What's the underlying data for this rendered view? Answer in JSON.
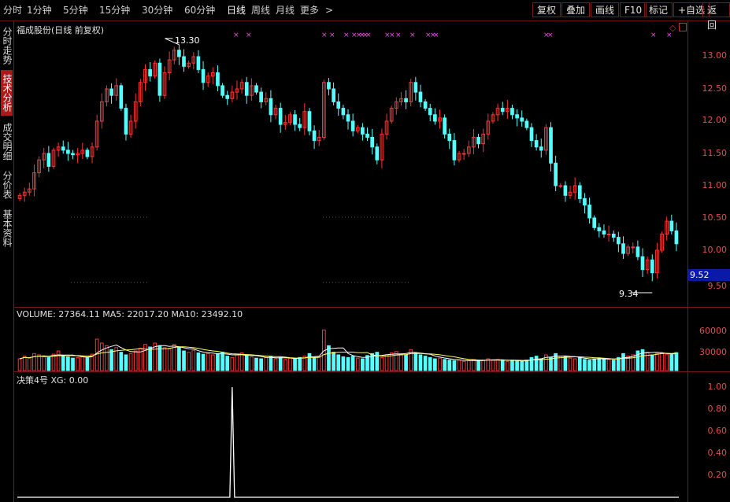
{
  "toolbar": {
    "periods": [
      "分时",
      "1分钟",
      "5分钟",
      "15分钟",
      "30分钟",
      "60分钟",
      "日线",
      "周线",
      "月线",
      "更多"
    ],
    "active_period": "日线",
    "more_arrow": ">",
    "buttons": [
      "复权",
      "叠加",
      "画线",
      "F10",
      "标记",
      "+自选",
      "返回"
    ]
  },
  "sidebar": {
    "tabs": [
      "分时走势",
      "技术分析",
      "成交明细",
      "分价表",
      "基本资料"
    ],
    "active": "技术分析"
  },
  "main_panel": {
    "title": "福成股份(日线 前复权)",
    "high_label": "13.30",
    "low_label": "9.34",
    "current_price": "9.52",
    "axis_labels": [
      "13.00",
      "12.50",
      "12.00",
      "11.50",
      "11.00",
      "10.50",
      "10.00",
      "9.50"
    ]
  },
  "volume_panel": {
    "title": "VOLUME: 27364.11  MA5: 22017.20  MA10: 23492.10",
    "axis_labels": [
      "60000",
      "30000"
    ]
  },
  "indicator_panel": {
    "title": "决策4号  XG: 0.00",
    "axis_labels": [
      "1.00",
      "0.80",
      "0.60",
      "0.40",
      "0.20"
    ]
  },
  "colors": {
    "up": "#ff3232",
    "down": "#54ffff",
    "frame": "#7a1a1a",
    "marker": "#ff40ff",
    "ma5": "#ffffff",
    "ma10": "#ffff60"
  },
  "chart_data": {
    "type": "candlestick",
    "closes": [
      10.85,
      10.9,
      10.95,
      11.2,
      11.4,
      11.5,
      11.3,
      11.55,
      11.6,
      11.55,
      11.5,
      11.48,
      11.5,
      11.55,
      11.45,
      11.6,
      12.0,
      12.3,
      12.5,
      12.4,
      12.55,
      12.2,
      11.8,
      12.0,
      12.3,
      12.6,
      12.8,
      12.7,
      12.9,
      12.4,
      12.75,
      12.95,
      13.1,
      13.0,
      12.85,
      12.9,
      13.0,
      12.8,
      12.6,
      12.7,
      12.75,
      12.55,
      12.4,
      12.35,
      12.45,
      12.5,
      12.6,
      12.4,
      12.55,
      12.45,
      12.3,
      12.35,
      12.1,
      12.2,
      11.95,
      11.98,
      12.1,
      11.95,
      11.9,
      12.15,
      11.85,
      11.7,
      11.75,
      12.6,
      12.5,
      12.3,
      12.2,
      12.1,
      12.0,
      11.85,
      11.9,
      11.8,
      11.75,
      11.6,
      11.4,
      11.8,
      12.0,
      12.2,
      12.3,
      12.35,
      12.3,
      12.6,
      12.45,
      12.3,
      12.2,
      12.1,
      12.0,
      12.05,
      11.8,
      11.7,
      11.4,
      11.5,
      11.5,
      11.6,
      11.75,
      11.65,
      11.8,
      12.0,
      12.1,
      12.2,
      12.15,
      12.2,
      12.1,
      12.05,
      12.0,
      11.9,
      11.7,
      11.6,
      11.55,
      11.9,
      11.35,
      11.0,
      11.0,
      10.85,
      10.9,
      11.0,
      10.8,
      10.7,
      10.5,
      10.35,
      10.3,
      10.25,
      10.25,
      10.2,
      10.1,
      9.95,
      10.05,
      10.05,
      9.9,
      9.7,
      9.85,
      9.65,
      10.0,
      10.25,
      10.45,
      10.3,
      10.1
    ],
    "volume": [
      18000,
      22000,
      19000,
      26000,
      24000,
      21000,
      20000,
      25000,
      30000,
      23000,
      21000,
      19000,
      20000,
      22000,
      20000,
      25000,
      48000,
      42000,
      38000,
      32000,
      35000,
      28000,
      24000,
      26000,
      30000,
      34000,
      40000,
      36000,
      42000,
      38000,
      35000,
      33000,
      40000,
      36000,
      30000,
      28000,
      31000,
      27000,
      25000,
      26000,
      24000,
      26000,
      28000,
      22000,
      20000,
      24000,
      27000,
      23000,
      21000,
      19000,
      18000,
      20000,
      22000,
      18000,
      20000,
      17000,
      19000,
      18000,
      20000,
      22000,
      26000,
      20000,
      21000,
      62000,
      38000,
      28000,
      24000,
      21000,
      20000,
      22000,
      19000,
      18000,
      23000,
      26000,
      28000,
      20000,
      24000,
      27000,
      29000,
      26000,
      24000,
      32000,
      27000,
      24000,
      22000,
      20000,
      18000,
      19000,
      17000,
      16000,
      15000,
      16000,
      14000,
      15000,
      17000,
      15000,
      16000,
      18000,
      16000,
      17000,
      15000,
      14000,
      16000,
      15000,
      14000,
      16000,
      20000,
      22000,
      18000,
      24000,
      20000,
      26000,
      22000,
      21000,
      19000,
      18000,
      20000,
      17000,
      16000,
      18000,
      19000,
      18000,
      17000,
      16000,
      20000,
      26000,
      22000,
      24000,
      30000,
      32000,
      28000,
      24000,
      26000,
      27000,
      25000,
      24000,
      27364
    ],
    "xg_signal_index": 44,
    "ylim": [
      9.3,
      13.4
    ]
  }
}
